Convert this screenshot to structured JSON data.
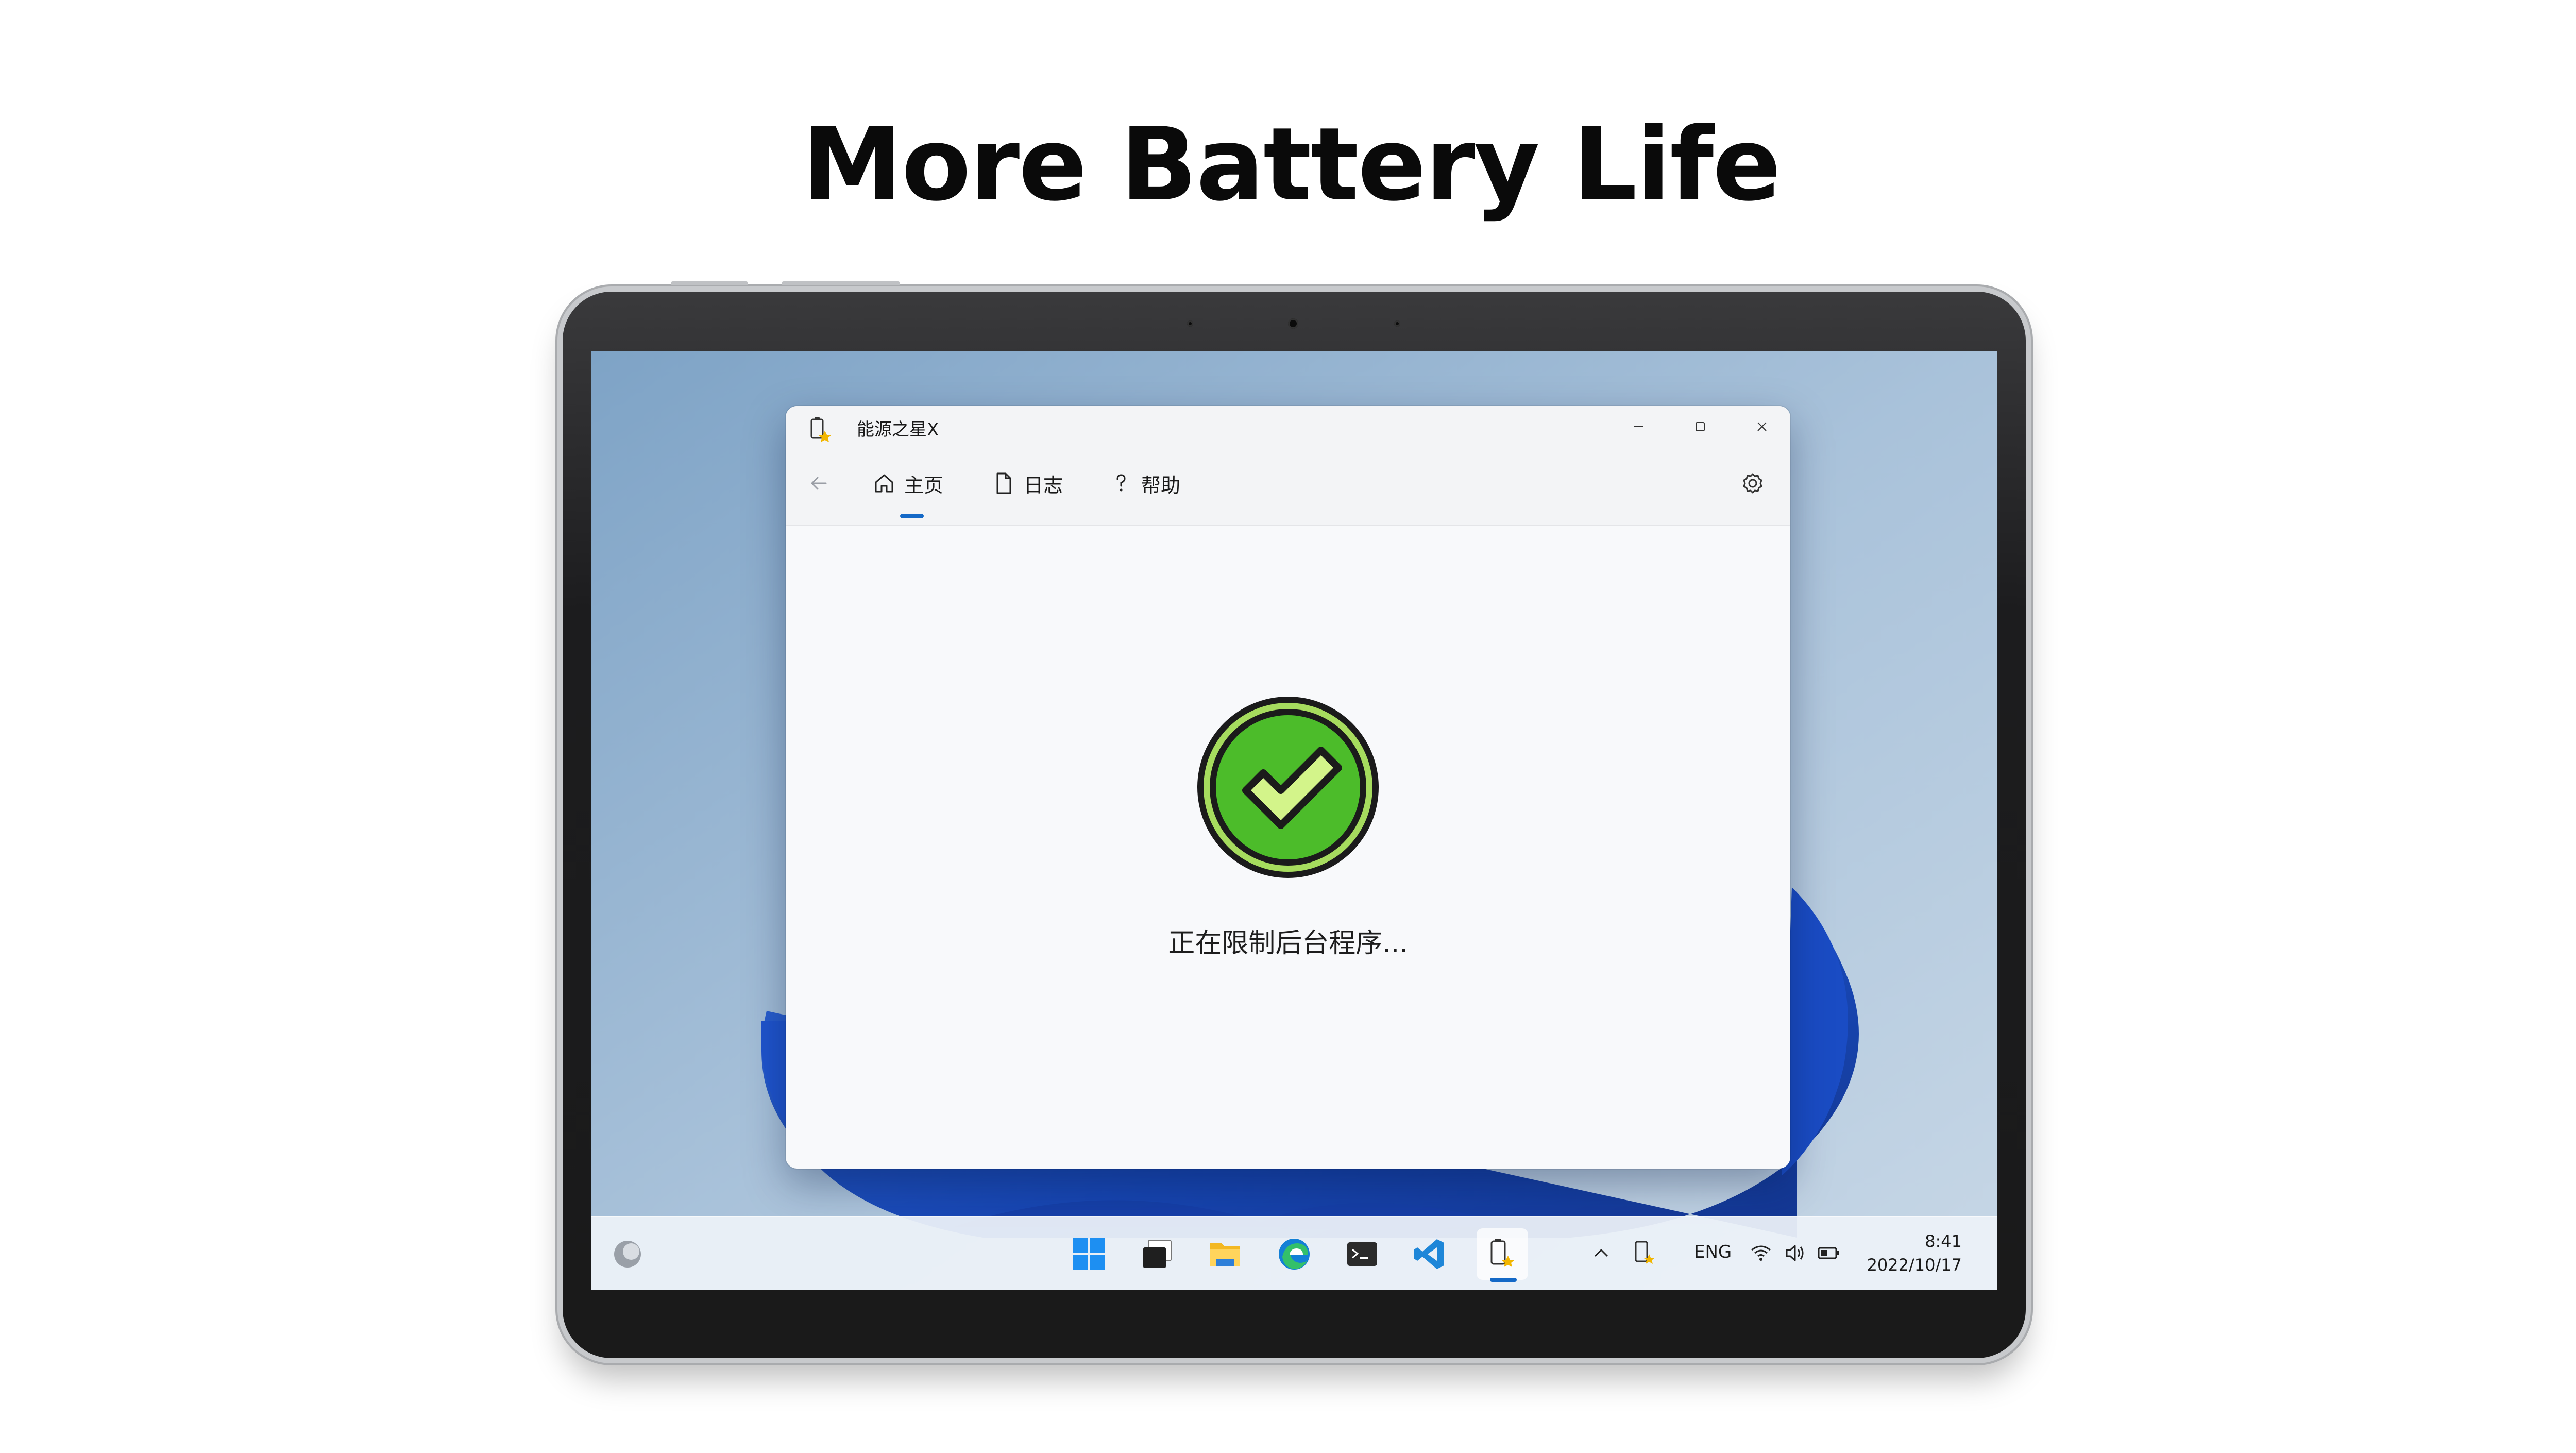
{
  "headline": "More Battery Life",
  "app": {
    "title": "能源之星X",
    "nav": {
      "home": "主页",
      "log": "日志",
      "help": "帮助"
    },
    "status": "正在限制后台程序..."
  },
  "taskbar": {
    "language": "ENG",
    "time": "8:41",
    "date": "2022/10/17"
  },
  "icons": {
    "app_icon": "battery-star-icon",
    "back": "back-arrow-icon",
    "home": "home-icon",
    "log": "document-icon",
    "help": "question-icon",
    "settings": "gear-icon",
    "status": "check-circle-icon"
  },
  "colors": {
    "accent": "#1469c7",
    "success_green": "#4cbc2a",
    "check_fill": "#d3f48a"
  }
}
